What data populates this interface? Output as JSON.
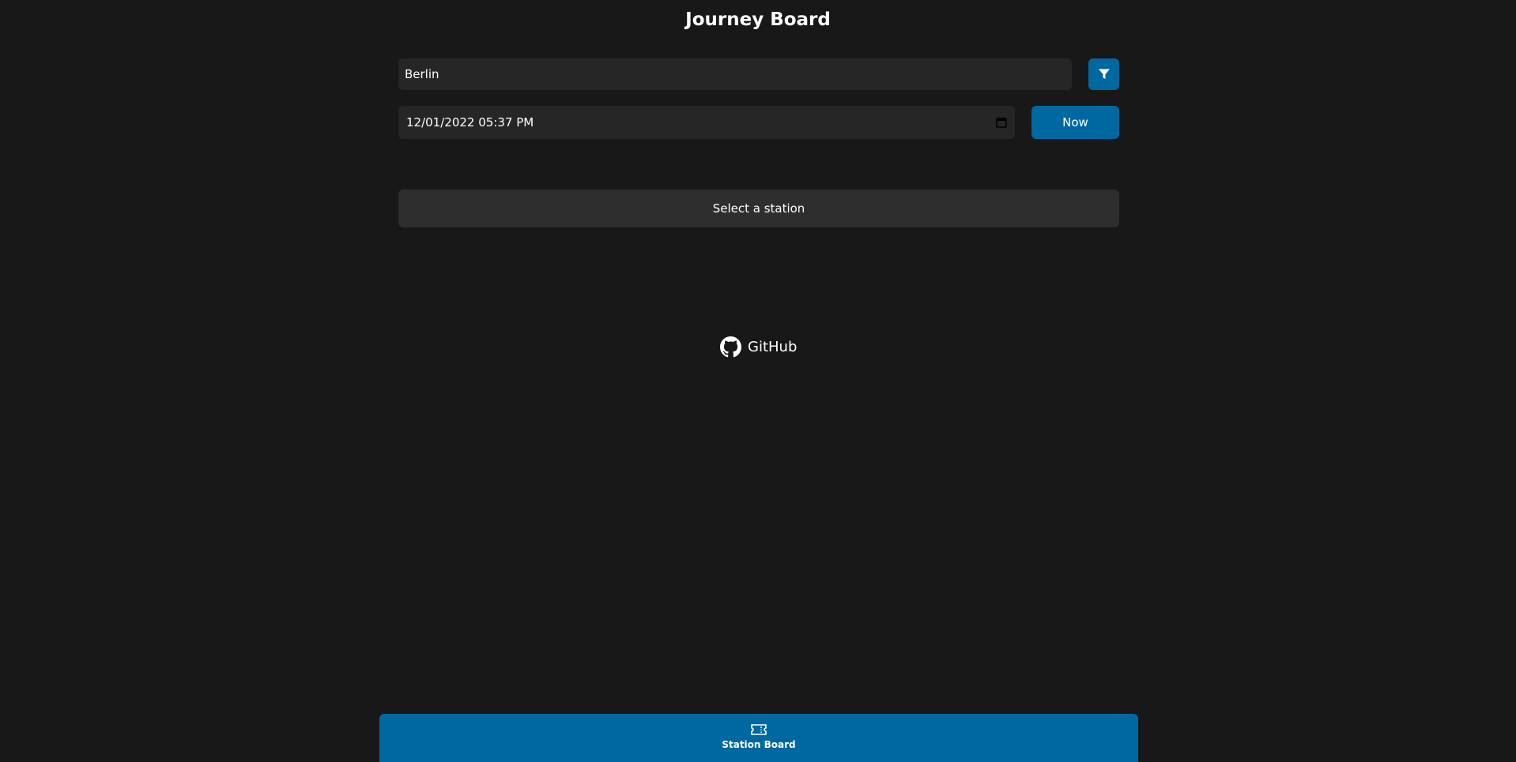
{
  "header": {
    "title": "Journey Board"
  },
  "search": {
    "station_value": "Berlin"
  },
  "filter": {
    "icon": "filter-icon"
  },
  "datetime": {
    "value": "12/01/2022 05:37 PM",
    "icon": "calendar-icon"
  },
  "now_button": {
    "label": "Now"
  },
  "results": {
    "placeholder": "Select a station"
  },
  "footer": {
    "github_label": "GitHub",
    "github_icon": "github-icon"
  },
  "bottom_nav": {
    "items": [
      {
        "label": "Station Board",
        "icon": "ticket-icon"
      }
    ]
  },
  "colors": {
    "background": "#181818",
    "input_background": "#262626",
    "panel_background": "#2e2e2e",
    "accent": "#0068a1",
    "text": "#ffffff"
  }
}
